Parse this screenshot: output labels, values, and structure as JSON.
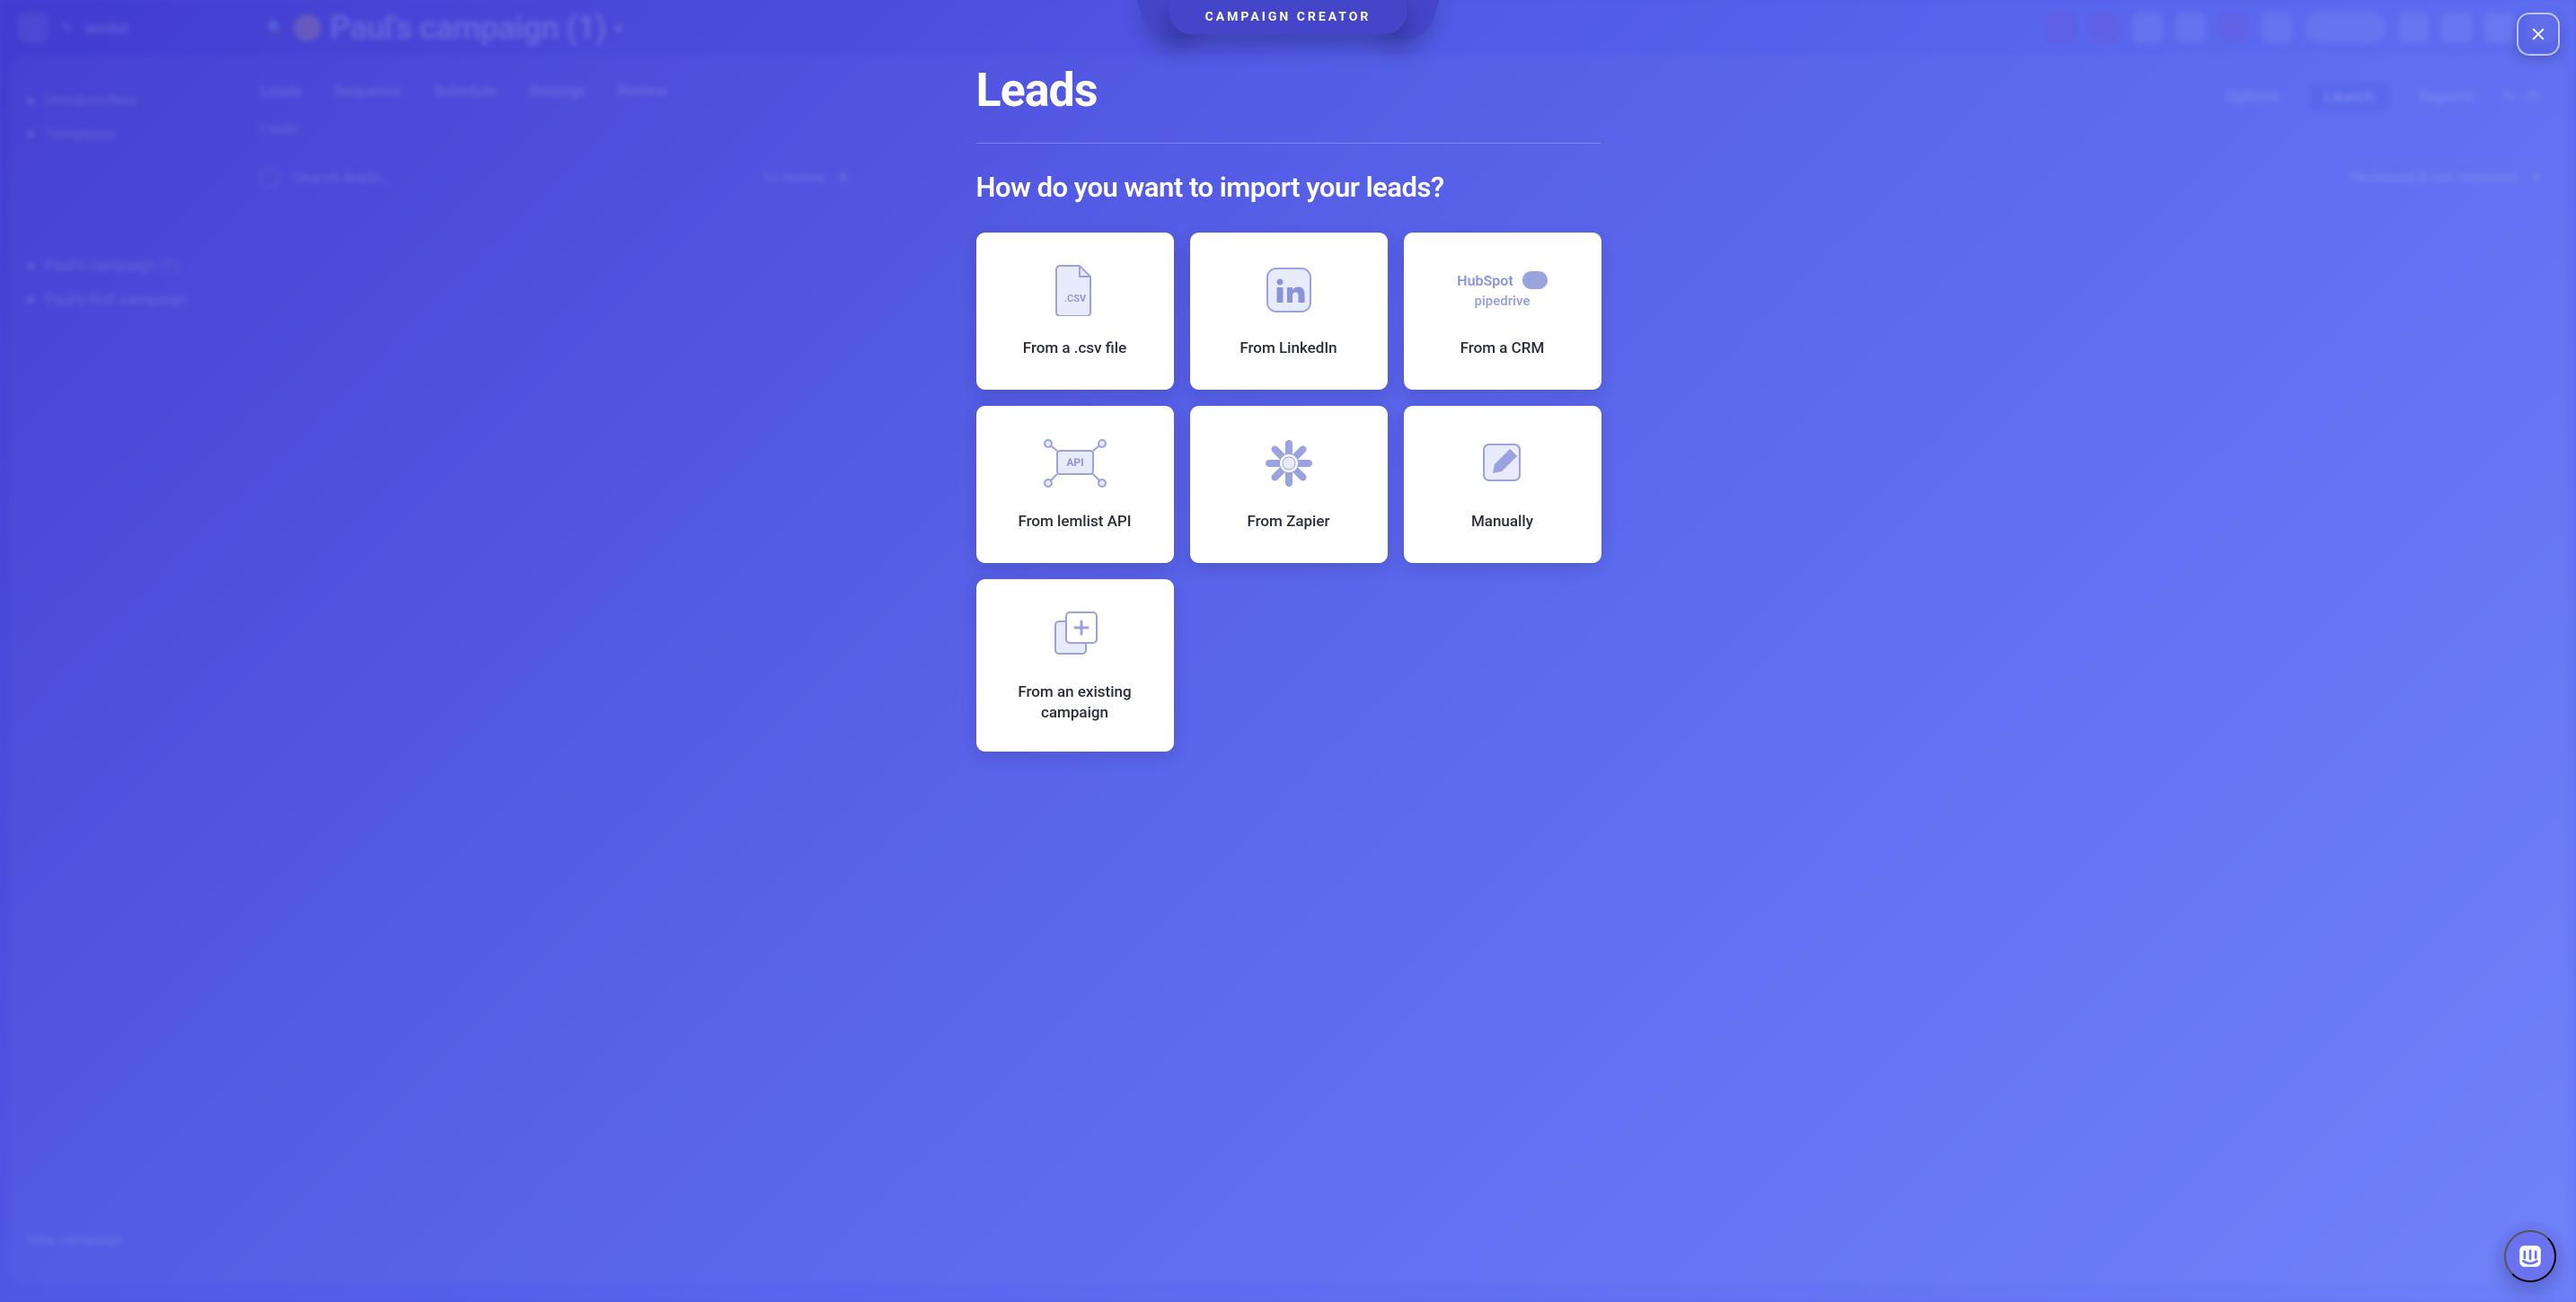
{
  "ribbon": {
    "label": "CAMPAIGN CREATOR"
  },
  "close": {
    "label": "Close"
  },
  "modal": {
    "title": "Leads",
    "subtitle": "How do you want to import your leads?",
    "cards": {
      "csv": {
        "label": "From a .csv file"
      },
      "linkedin": {
        "label": "From LinkedIn"
      },
      "crm": {
        "label": "From a CRM",
        "logos": {
          "hubspot": "HubSpot",
          "pipedrive": "pipedrive"
        }
      },
      "api": {
        "label": "From lemlist API",
        "badge": "API"
      },
      "zapier": {
        "label": "From Zapier"
      },
      "manual": {
        "label": "Manually"
      },
      "existing": {
        "label": "From an existing campaign"
      }
    }
  },
  "background": {
    "brand": "lemlist",
    "campaign_title": "Paul's campaign (1)",
    "tabs": {
      "leads": "Leads",
      "sequence": "Sequence",
      "schedule": "Schedule",
      "settings": "Settings",
      "review": "Review",
      "options": "Options",
      "launch": "Launch",
      "reports": "Reports"
    },
    "filter_bar": {
      "placeholder": "Search leads…",
      "review_label": "to review",
      "reviewed_label": "Reviewed & not reviewed"
    },
    "sidebar": {
      "unsubscribes": "Unsubscribes",
      "templates": "Templates",
      "campaign1": "Paul's campaign (1)",
      "campaign2": "Paul's first campaign",
      "new_campaign": "New campaign"
    }
  },
  "chat": {
    "label": "Chat"
  }
}
